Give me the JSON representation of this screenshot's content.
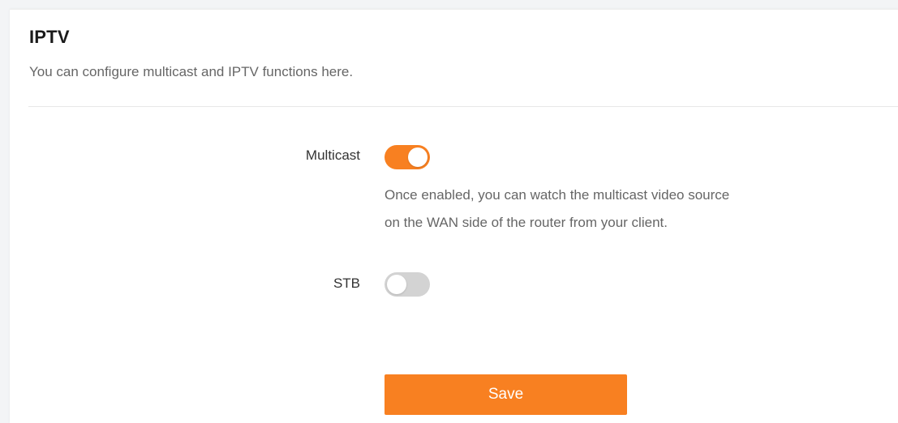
{
  "page": {
    "title": "IPTV",
    "subtitle": "You can configure multicast and IPTV functions here."
  },
  "settings": {
    "multicast": {
      "label": "Multicast",
      "enabled": true,
      "hint_line1": "Once enabled, you can watch the multicast video source",
      "hint_line2": "on the WAN side of the router from your client."
    },
    "stb": {
      "label": "STB",
      "enabled": false
    }
  },
  "actions": {
    "save_label": "Save"
  },
  "colors": {
    "accent": "#f88021",
    "toggle_off": "#d3d3d3"
  },
  "icons": {
    "multicast_toggle": "toggle-switch-icon",
    "stb_toggle": "toggle-switch-icon"
  }
}
